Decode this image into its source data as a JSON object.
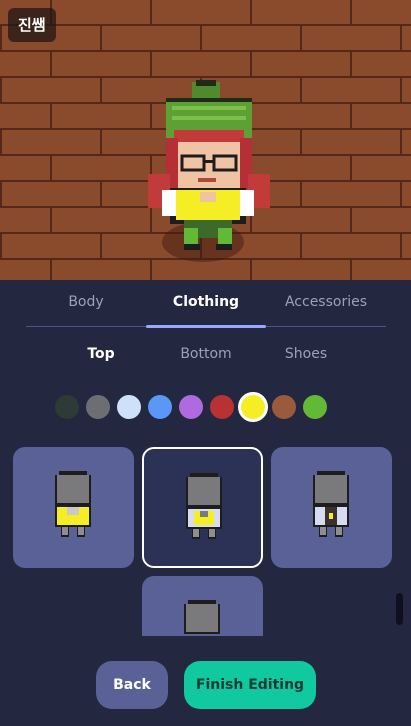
{
  "player": {
    "name": "진쌤"
  },
  "editor": {
    "tabs": [
      "Body",
      "Clothing",
      "Accessories"
    ],
    "active_tab": "Clothing",
    "subtabs": [
      "Top",
      "Bottom",
      "Shoes"
    ],
    "active_subtab": "Top",
    "colors": [
      "#2e3a35",
      "#6c6f72",
      "#cfe0fb",
      "#5b97f6",
      "#b06ae0",
      "#b83234",
      "#f6ee25",
      "#9a5a3c",
      "#62b936"
    ],
    "selected_color": "#f6ee25",
    "options": [
      {
        "style": "vest",
        "selected": false
      },
      {
        "style": "tee",
        "selected": true
      },
      {
        "style": "jacket",
        "selected": false
      },
      {
        "style": "plain",
        "selected": false
      }
    ]
  },
  "buttons": {
    "back": "Back",
    "finish": "Finish Editing"
  }
}
